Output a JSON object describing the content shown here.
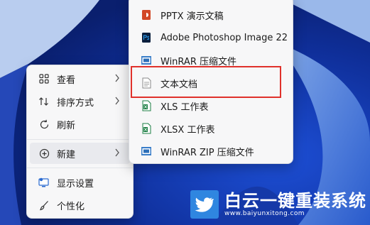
{
  "context_menu": {
    "items": [
      {
        "label": "查看",
        "icon": "grid-view-icon",
        "has_submenu": true
      },
      {
        "label": "排序方式",
        "icon": "sort-arrows-icon",
        "has_submenu": true
      },
      {
        "label": "刷新",
        "icon": "refresh-icon",
        "has_submenu": false
      },
      {
        "label": "新建",
        "icon": "add-circle-icon",
        "has_submenu": true
      },
      {
        "label": "显示设置",
        "icon": "display-settings-icon",
        "has_submenu": false
      },
      {
        "label": "个性化",
        "icon": "brush-icon",
        "has_submenu": false
      }
    ]
  },
  "new_submenu": {
    "items": [
      {
        "label": "PPTX 演示文稿",
        "icon": "powerpoint-file-icon"
      },
      {
        "label": "Adobe Photoshop Image 22",
        "icon": "photoshop-file-icon"
      },
      {
        "label": "WinRAR 压缩文件",
        "icon": "winrar-archive-icon"
      },
      {
        "label": "文本文档",
        "icon": "text-document-icon"
      },
      {
        "label": "XLS 工作表",
        "icon": "excel-xls-file-icon"
      },
      {
        "label": "XLSX 工作表",
        "icon": "excel-xlsx-file-icon"
      },
      {
        "label": "WinRAR ZIP 压缩文件",
        "icon": "winrar-zip-icon"
      }
    ],
    "highlighted": "文本文档"
  },
  "watermark": {
    "title": "白云一键重装系统",
    "url": "www.baiyunxitong.com"
  },
  "colors": {
    "highlight_border": "#e0312b",
    "wallpaper_blue": "#1a3fa8",
    "menu_background": "#f7f7f8"
  }
}
